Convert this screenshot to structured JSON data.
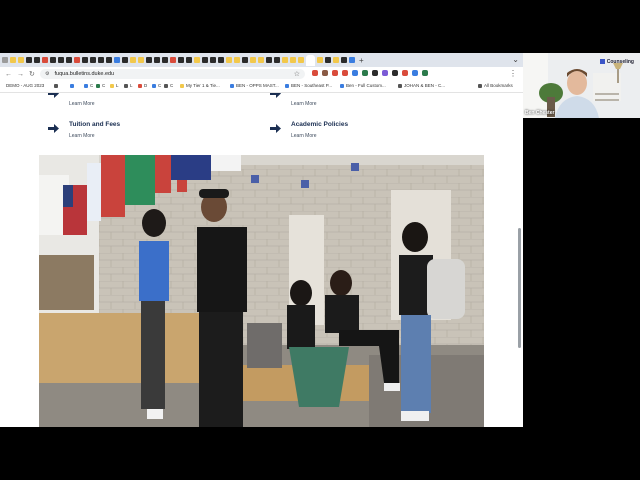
{
  "tabs": {
    "favicon_colors": [
      "#9c9c9c",
      "#f2c84b",
      "#f2c84b",
      "#2b2b2b",
      "#2b2b2b",
      "#d94b3b",
      "#2b2b2b",
      "#2b2b2b",
      "#2b2b2b",
      "#d94b3b",
      "#2b2b2b",
      "#2b2b2b",
      "#2b2b2b",
      "#2b2b2b",
      "#3a7de0",
      "#2b2b2b",
      "#f2c84b",
      "#f2c84b",
      "#2b2b2b",
      "#2b2b2b",
      "#2b2b2b",
      "#d94b3b",
      "#2b2b2b",
      "#2b2b2b",
      "#f2c84b",
      "#2b2b2b",
      "#2b2b2b",
      "#2b2b2b",
      "#f2c84b",
      "#f2c84b",
      "#2b2b2b",
      "#f2c84b",
      "#f2c84b",
      "#2b2b2b",
      "#2b2b2b",
      "#f2c84b",
      "#f2c84b",
      "#f2c84b",
      "#f2c84b",
      "#2b2b2b",
      "#f2c84b",
      "#2b2b2b",
      "#3a7de0"
    ],
    "new_tab": "+",
    "window_controls": "⌄"
  },
  "toolbar": {
    "back": "←",
    "forward": "→",
    "reload": "↻",
    "url": "fuqua.bulletins.duke.edu",
    "star": "☆",
    "extension_colors": [
      "#d94b3b",
      "#8a5a44",
      "#d94b3b",
      "#d94b3b",
      "#3a7de0",
      "#2b7a4b",
      "#2b2b2b",
      "#7b5bd6",
      "#2b2b2b",
      "#d94b3b",
      "#3a7de0",
      "#2b7a4b"
    ],
    "menu": "⋮"
  },
  "bookmarks": {
    "items": [
      {
        "label": "DEMO - AUG 2023",
        "color": ""
      },
      {
        "label": "",
        "color": "#555555"
      },
      {
        "label": "",
        "color": "#3a7de0"
      },
      {
        "label": "C",
        "color": "#3a7de0"
      },
      {
        "label": "C",
        "color": "#2b7a4b"
      },
      {
        "label": "L",
        "color": "#f2c84b"
      },
      {
        "label": "L",
        "color": "#555555"
      },
      {
        "label": "D",
        "color": "#d94b3b"
      },
      {
        "label": "C",
        "color": "#3a7de0"
      },
      {
        "label": "C",
        "color": "#555555"
      },
      {
        "label": "My Tier 1 & Tie...",
        "color": "#f2c84b"
      },
      {
        "label": "BEN - OPPS MAST...",
        "color": "#3a7de0"
      },
      {
        "label": "BEN - Southeast P...",
        "color": "#3a7de0"
      },
      {
        "label": "Ben - Full Custom...",
        "color": "#3a7de0"
      },
      {
        "label": "JOHAN & BEN - C...",
        "color": "#555555"
      }
    ],
    "all_bookmarks": "All Bookmarks"
  },
  "page": {
    "links": [
      {
        "title": "",
        "learn_more": "Learn More"
      },
      {
        "title": "",
        "learn_more": "Learn More"
      },
      {
        "title": "Tuition and Fees",
        "learn_more": "Learn More"
      },
      {
        "title": "Academic Policies",
        "learn_more": "Learn More"
      }
    ],
    "brand_color": "#1b2f52"
  },
  "video_tile": {
    "name": "Ben Chester",
    "label": "Counseling"
  }
}
